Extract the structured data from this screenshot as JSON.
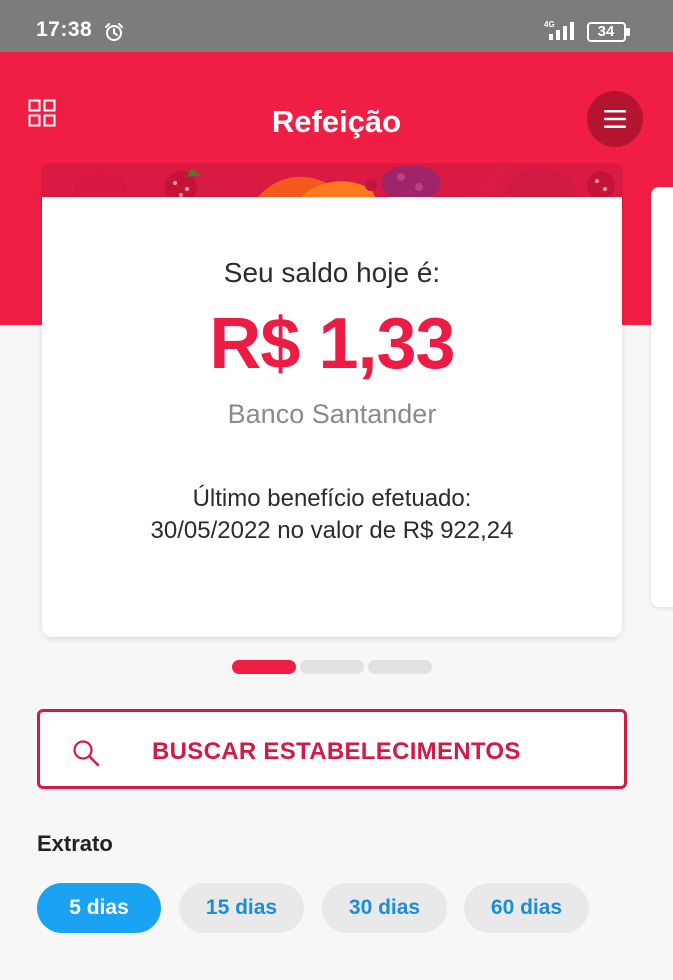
{
  "status_bar": {
    "time": "17:38",
    "network": "4G",
    "battery": "34",
    "icons": [
      "alarm-icon",
      "signal-icon",
      "battery-icon"
    ]
  },
  "header": {
    "title": "Refeição",
    "left_icon": "grid-icon",
    "right_icon": "menu-icon"
  },
  "balance_card": {
    "label": "Seu saldo hoje é:",
    "amount": "R$ 1,33",
    "bank": "Banco Santander",
    "last_benefit_line1": "Último benefício efetuado:",
    "last_benefit_line2": "30/05/2022 no valor de R$ 922,24"
  },
  "pager": {
    "total": 3,
    "active_index": 0
  },
  "search": {
    "label": "BUSCAR ESTABELECIMENTOS",
    "icon": "search-icon"
  },
  "statement": {
    "title": "Extrato",
    "filters": [
      {
        "label": "5 dias",
        "selected": true
      },
      {
        "label": "15 dias",
        "selected": false
      },
      {
        "label": "30 dias",
        "selected": false
      },
      {
        "label": "60 dias",
        "selected": false
      }
    ]
  },
  "colors": {
    "brand": "#f01e44",
    "brand_dark": "#b4142f",
    "balance": "#ec1c44",
    "button_border": "#d21a46",
    "chip_selected": "#1aa3f3",
    "chip_unselected_bg": "#e9e9e9",
    "chip_unselected_text": "#1a8fd6",
    "status_bar": "#7c7c7c"
  }
}
